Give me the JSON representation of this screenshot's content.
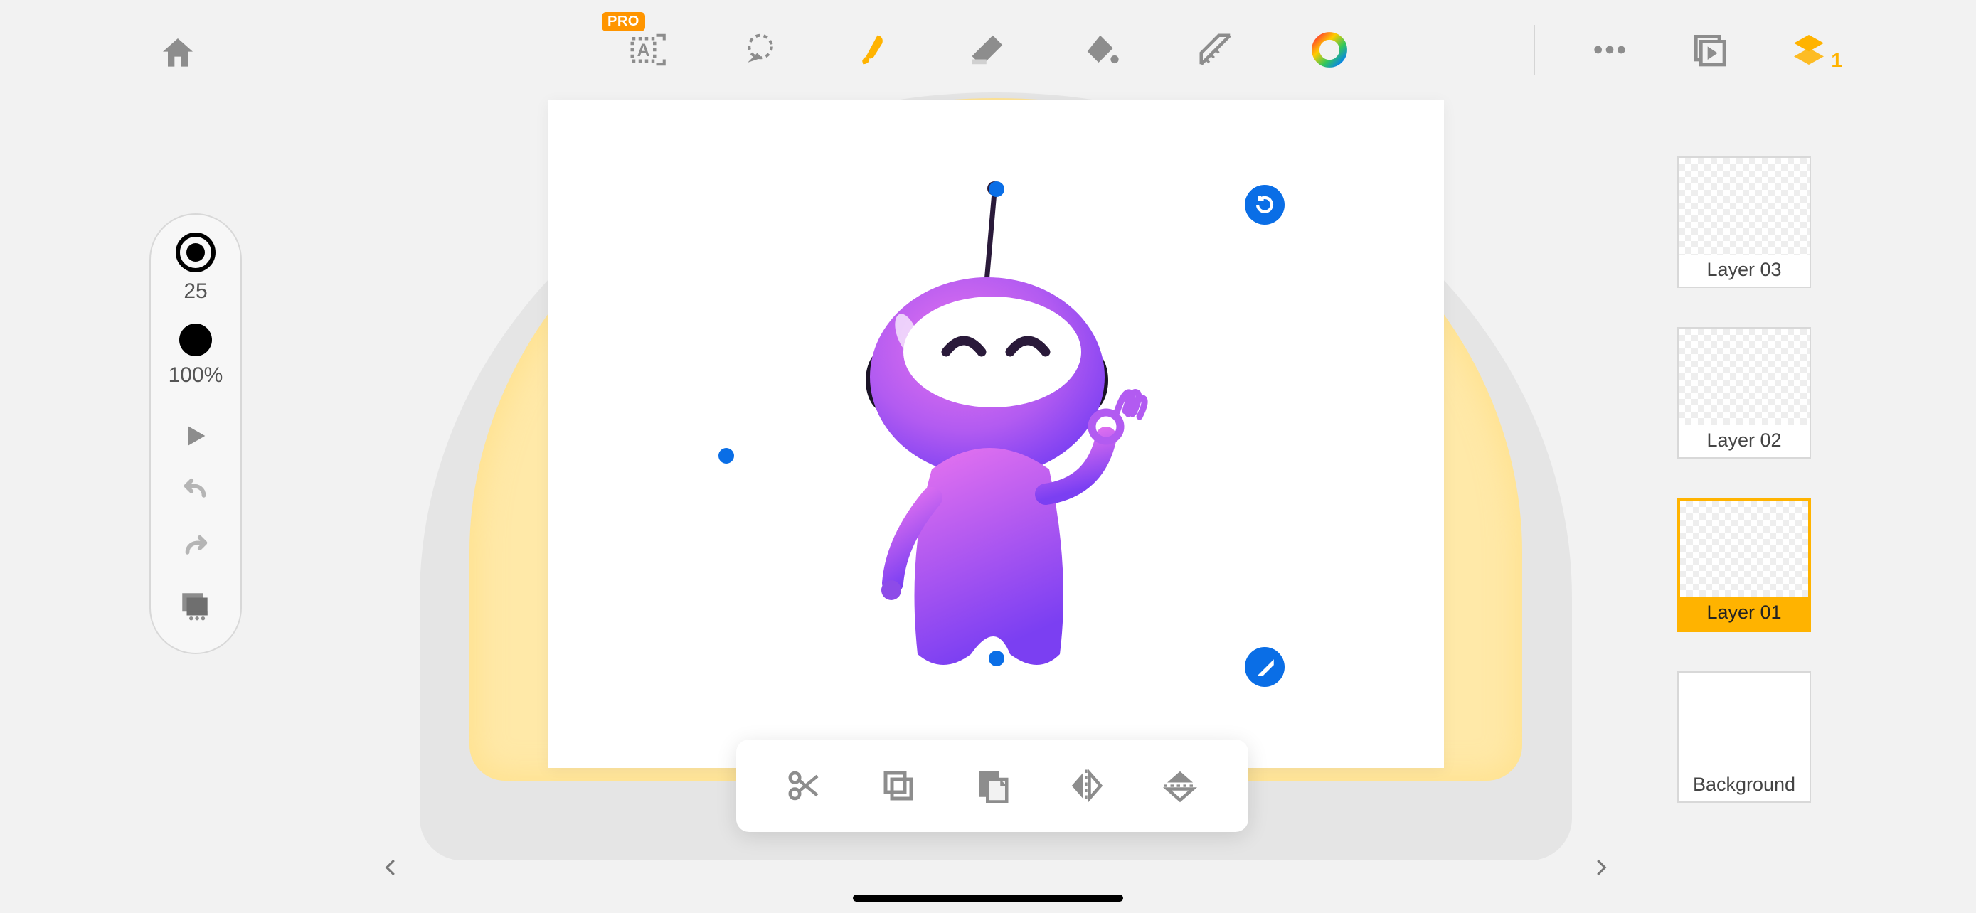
{
  "pro_badge": "PRO",
  "left_panel": {
    "brush_size": "25",
    "opacity": "100%"
  },
  "layers": [
    {
      "label": "Layer 03",
      "selected": false,
      "transparent": true
    },
    {
      "label": "Layer 02",
      "selected": false,
      "transparent": true
    },
    {
      "label": "Layer 01",
      "selected": true,
      "transparent": true
    },
    {
      "label": "Background",
      "selected": false,
      "transparent": false
    }
  ],
  "layers_badge": "1",
  "colors": {
    "accent": "#ffb300",
    "selection": "#0a6ee6",
    "icon": "#8d8d8d"
  }
}
